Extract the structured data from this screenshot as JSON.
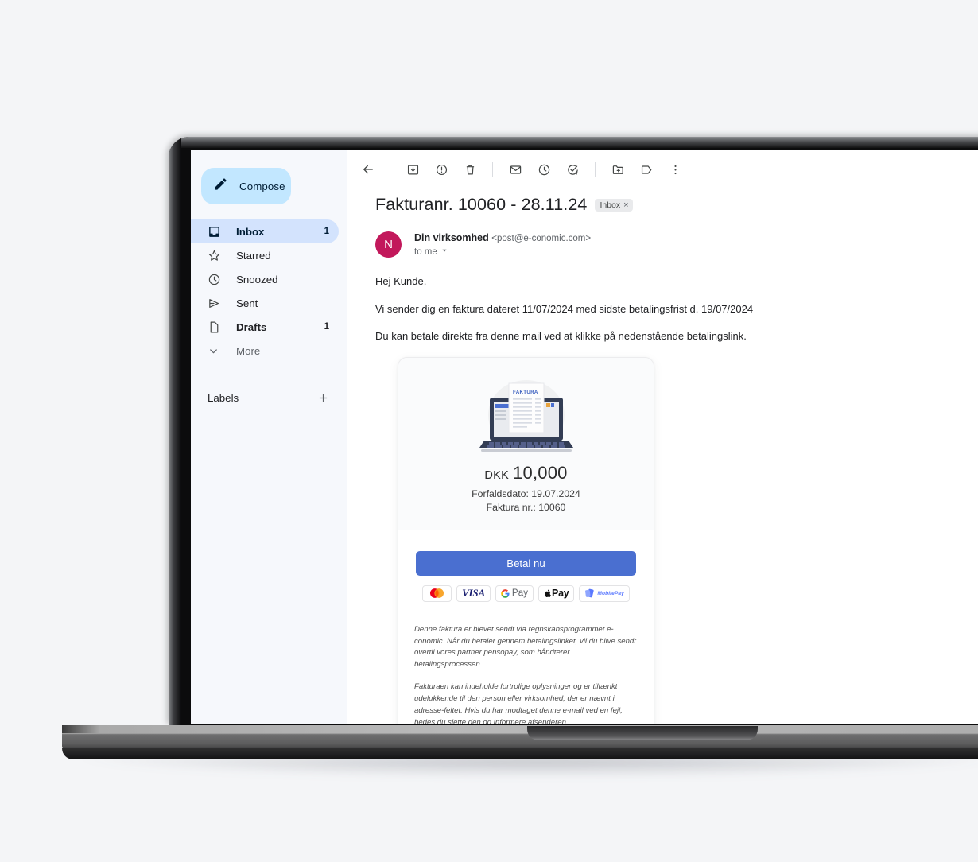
{
  "window": {
    "app": "Gmail"
  },
  "sidebar": {
    "compose": {
      "label": "Compose",
      "icon": "pencil-icon"
    },
    "items": [
      {
        "label": "Inbox",
        "count": "1",
        "icon": "inbox-icon",
        "active": true
      },
      {
        "label": "Starred",
        "count": "",
        "icon": "star-icon",
        "active": false
      },
      {
        "label": "Snoozed",
        "count": "",
        "icon": "clock-icon",
        "active": false
      },
      {
        "label": "Sent",
        "count": "",
        "icon": "send-icon",
        "active": false
      },
      {
        "label": "Drafts",
        "count": "1",
        "icon": "draft-icon",
        "active": false
      },
      {
        "label": "More",
        "count": "",
        "icon": "chevron-down-icon",
        "active": false
      }
    ],
    "labels": {
      "title": "Labels",
      "add_icon": "plus-icon"
    }
  },
  "toolbar": {
    "buttons": [
      {
        "name": "back-icon"
      },
      {
        "name": "archive-icon"
      },
      {
        "name": "report-spam-icon"
      },
      {
        "name": "delete-icon"
      },
      {
        "name": "mark-unread-icon"
      },
      {
        "name": "snooze-icon"
      },
      {
        "name": "add-to-tasks-icon"
      },
      {
        "name": "move-to-icon"
      },
      {
        "name": "labels-icon"
      },
      {
        "name": "more-options-icon"
      }
    ]
  },
  "email": {
    "subject": "Fakturanr. 10060 - 28.11.24",
    "label_chip": "Inbox",
    "label_chip_remove": "×",
    "sender_name": "Din virksomhed",
    "sender_email": "<post@e-conomic.com>",
    "to_line": "to me",
    "avatar_letter": "N",
    "avatar_color": "#c2185b",
    "body": [
      "Hej Kunde,",
      "Vi sender dig en faktura dateret 11/07/2024 med sidste betalingsfrist d. 19/07/2024",
      "Du kan betale direkte fra denne mail ved at klikke på nedenstående betalingslink."
    ]
  },
  "invoice_card": {
    "illustration_label": "FAKTURA",
    "currency": "DKK",
    "amount": "10,000",
    "due_date_line": "Forfaldsdato: 19.07.2024",
    "invoice_no_line": "Faktura nr.: 10060",
    "pay_button": "Betal nu",
    "pay_button_color": "#4a6fd0",
    "payment_methods": [
      {
        "name": "mastercard-logo",
        "text": ""
      },
      {
        "name": "visa-logo",
        "text": "VISA"
      },
      {
        "name": "google-pay-logo",
        "text": "Pay"
      },
      {
        "name": "apple-pay-logo",
        "text": "Pay"
      },
      {
        "name": "mobilepay-logo",
        "text": "MobilePay"
      }
    ],
    "footer": [
      "Denne faktura er blevet sendt via regnskabsprogrammet e-conomic. Når du betaler gennem betalingslinket, vil du blive sendt overtil vores partner pensopay, som håndterer betalingsprocessen.",
      "Fakturaen kan indeholde fortrolige oplysninger og er tiltænkt udelukkende til den person eller virksomhed, der er nævnt i adresse-feltet. Hvis du har modtaget denne e-mail ved en fejl, bedes du slette den og informere afsenderen."
    ]
  }
}
